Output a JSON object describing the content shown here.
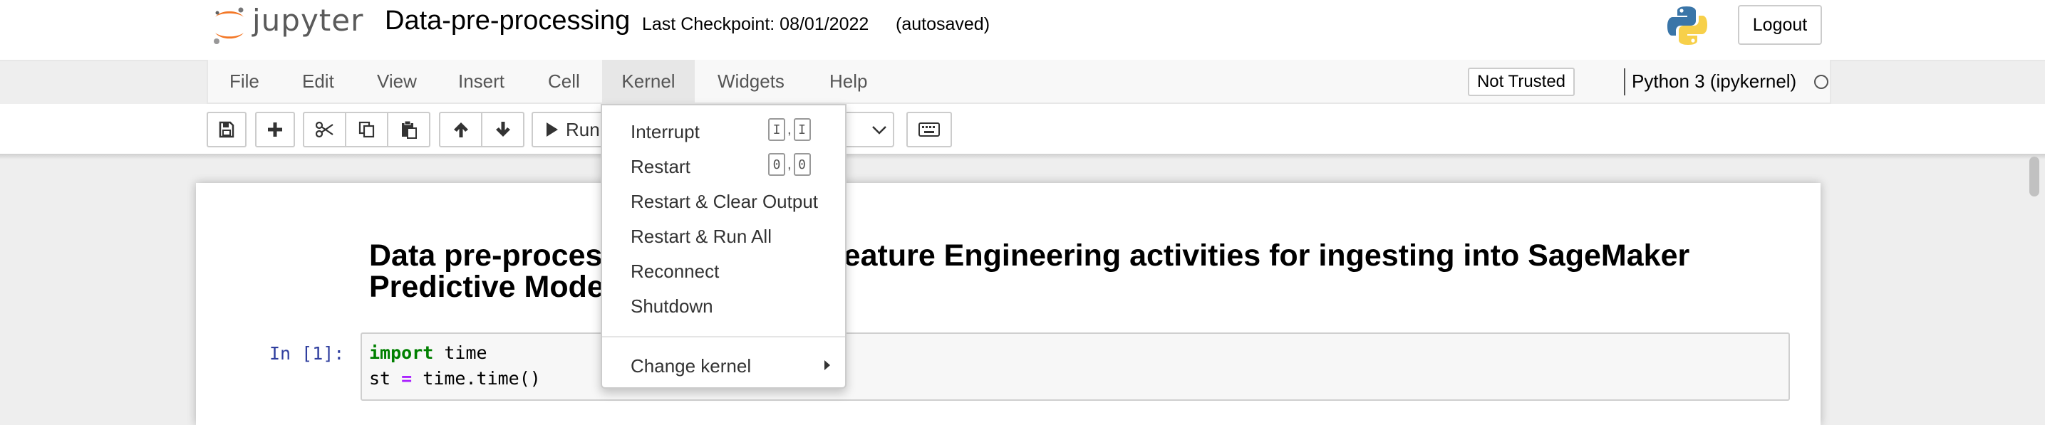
{
  "header": {
    "logo_text": "jupyter",
    "notebook_name": "Data-pre-processing",
    "checkpoint": "Last Checkpoint: 08/01/2022",
    "autosave": "(autosaved)",
    "logout": "Logout"
  },
  "menubar": {
    "items": [
      "File",
      "Edit",
      "View",
      "Insert",
      "Cell",
      "Kernel",
      "Widgets",
      "Help"
    ],
    "active": "Kernel",
    "trust": "Not Trusted",
    "kernel_name": "Python 3 (ipykernel)"
  },
  "toolbar": {
    "run_label": "Run",
    "buttons": [
      "save-icon",
      "plus-icon",
      "cut-icon",
      "copy-icon",
      "paste-icon",
      "arrow-up-icon",
      "arrow-down-icon",
      "run-icon",
      "keyboard-icon"
    ]
  },
  "kernel_menu": {
    "items": [
      {
        "label": "Interrupt",
        "shortcut": [
          "I",
          "I"
        ]
      },
      {
        "label": "Restart",
        "shortcut": [
          "0",
          "0"
        ]
      },
      {
        "label": "Restart & Clear Output"
      },
      {
        "label": "Restart & Run All"
      },
      {
        "label": "Reconnect"
      },
      {
        "label": "Shutdown"
      },
      {
        "label": "Change kernel"
      }
    ]
  },
  "notebook": {
    "heading_line1_left": "Data pre-proces",
    "heading_line1_right": "Feature Engineering activities for ingesting into SageMaker",
    "heading_line2": "Predictive Mode",
    "cell_prompt": "In [1]:",
    "code": {
      "l1_kw": "import",
      "l1_rest": " time",
      "l2_a": "st ",
      "l2_op": "=",
      "l2_b": " time.time()"
    }
  },
  "colors": {
    "accent_orange": "#f37726",
    "prompt_blue": "#303f9f",
    "keyword_green": "#008000",
    "operator_purple": "#aa22ff"
  }
}
